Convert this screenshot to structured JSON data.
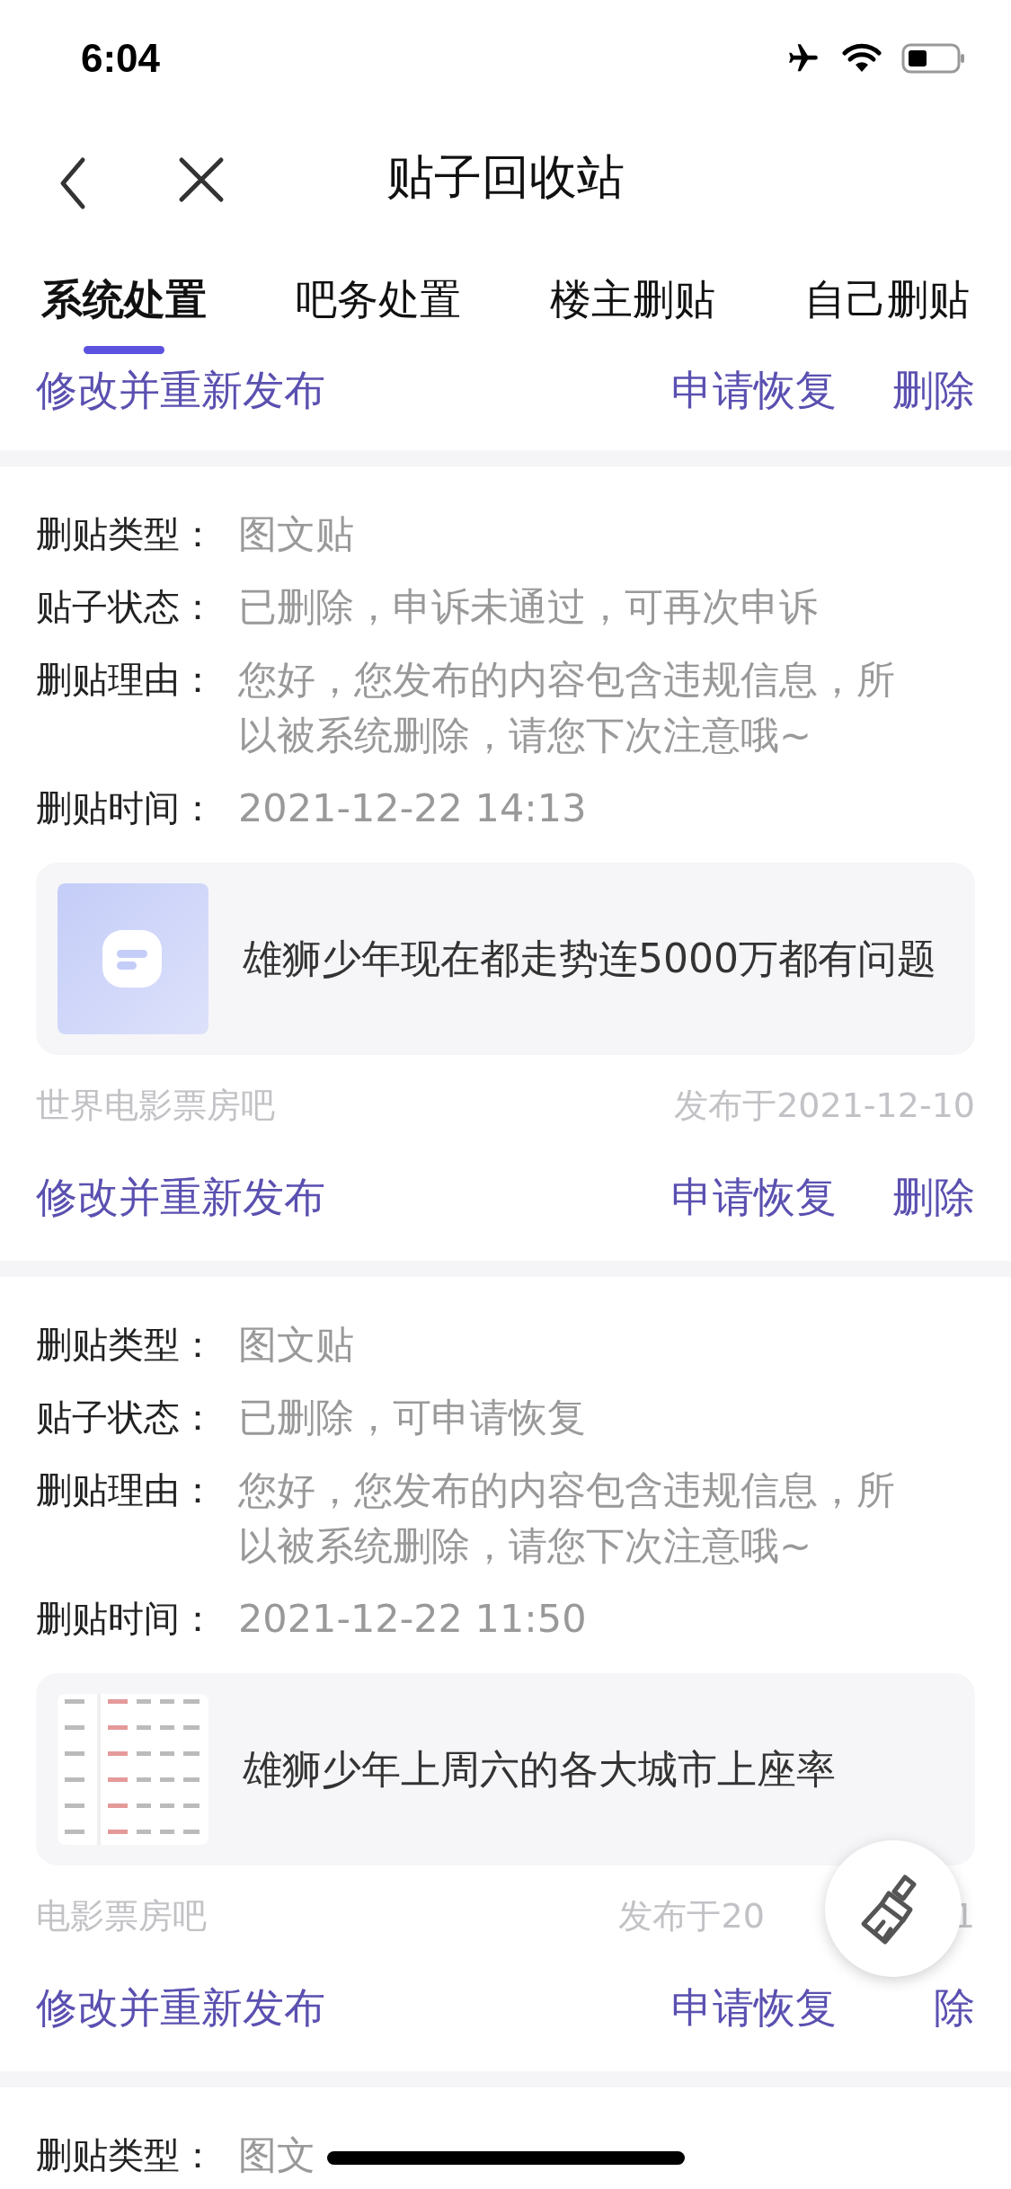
{
  "status_bar": {
    "time": "6:04"
  },
  "header": {
    "title": "贴子回收站"
  },
  "tabs": [
    {
      "label": "系统处置",
      "selected": true
    },
    {
      "label": "吧务处置",
      "selected": false
    },
    {
      "label": "楼主删贴",
      "selected": false
    },
    {
      "label": "自己删贴",
      "selected": false
    }
  ],
  "top_actions": [
    "修改并重新发布",
    "申请恢复",
    "删除"
  ],
  "cards": [
    {
      "fields": [
        {
          "label": "删贴类型：",
          "value": "图文贴"
        },
        {
          "label": "贴子状态：",
          "value": "已删除，申诉未通过，可再次申诉"
        },
        {
          "label": "删贴理由：",
          "value": "您好，您发布的内容包含违规信息，所以被系统删除，请您下次注意哦~"
        },
        {
          "label": "删贴时间：",
          "value": "2021-12-22 14:13"
        }
      ],
      "post": {
        "title": "雄狮少年现在都走势连5000万都有问题",
        "kind": "placeholder"
      },
      "forum": "世界电影票房吧",
      "date": "发布于2021-12-10",
      "actions": [
        "修改并重新发布",
        "申请恢复",
        "删除"
      ]
    },
    {
      "fields": [
        {
          "label": "删贴类型：",
          "value": "图文贴"
        },
        {
          "label": "贴子状态：",
          "value": "已删除，可申请恢复"
        },
        {
          "label": "删贴理由：",
          "value": "您好，您发布的内容包含违规信息，所以被系统删除，请您下次注意哦~"
        },
        {
          "label": "删贴时间：",
          "value": "2021-12-22 11:50"
        }
      ],
      "post": {
        "title": "雄狮少年上周六的各大城市上座率",
        "kind": "picture"
      },
      "forum": "电影票房吧",
      "date": "发布于20",
      "date_tail": "1",
      "actions": [
        "修改并重新发布",
        "申请恢复",
        "除"
      ]
    },
    {
      "fields": [
        {
          "label": "删贴类型：",
          "value": "图文"
        }
      ]
    }
  ]
}
